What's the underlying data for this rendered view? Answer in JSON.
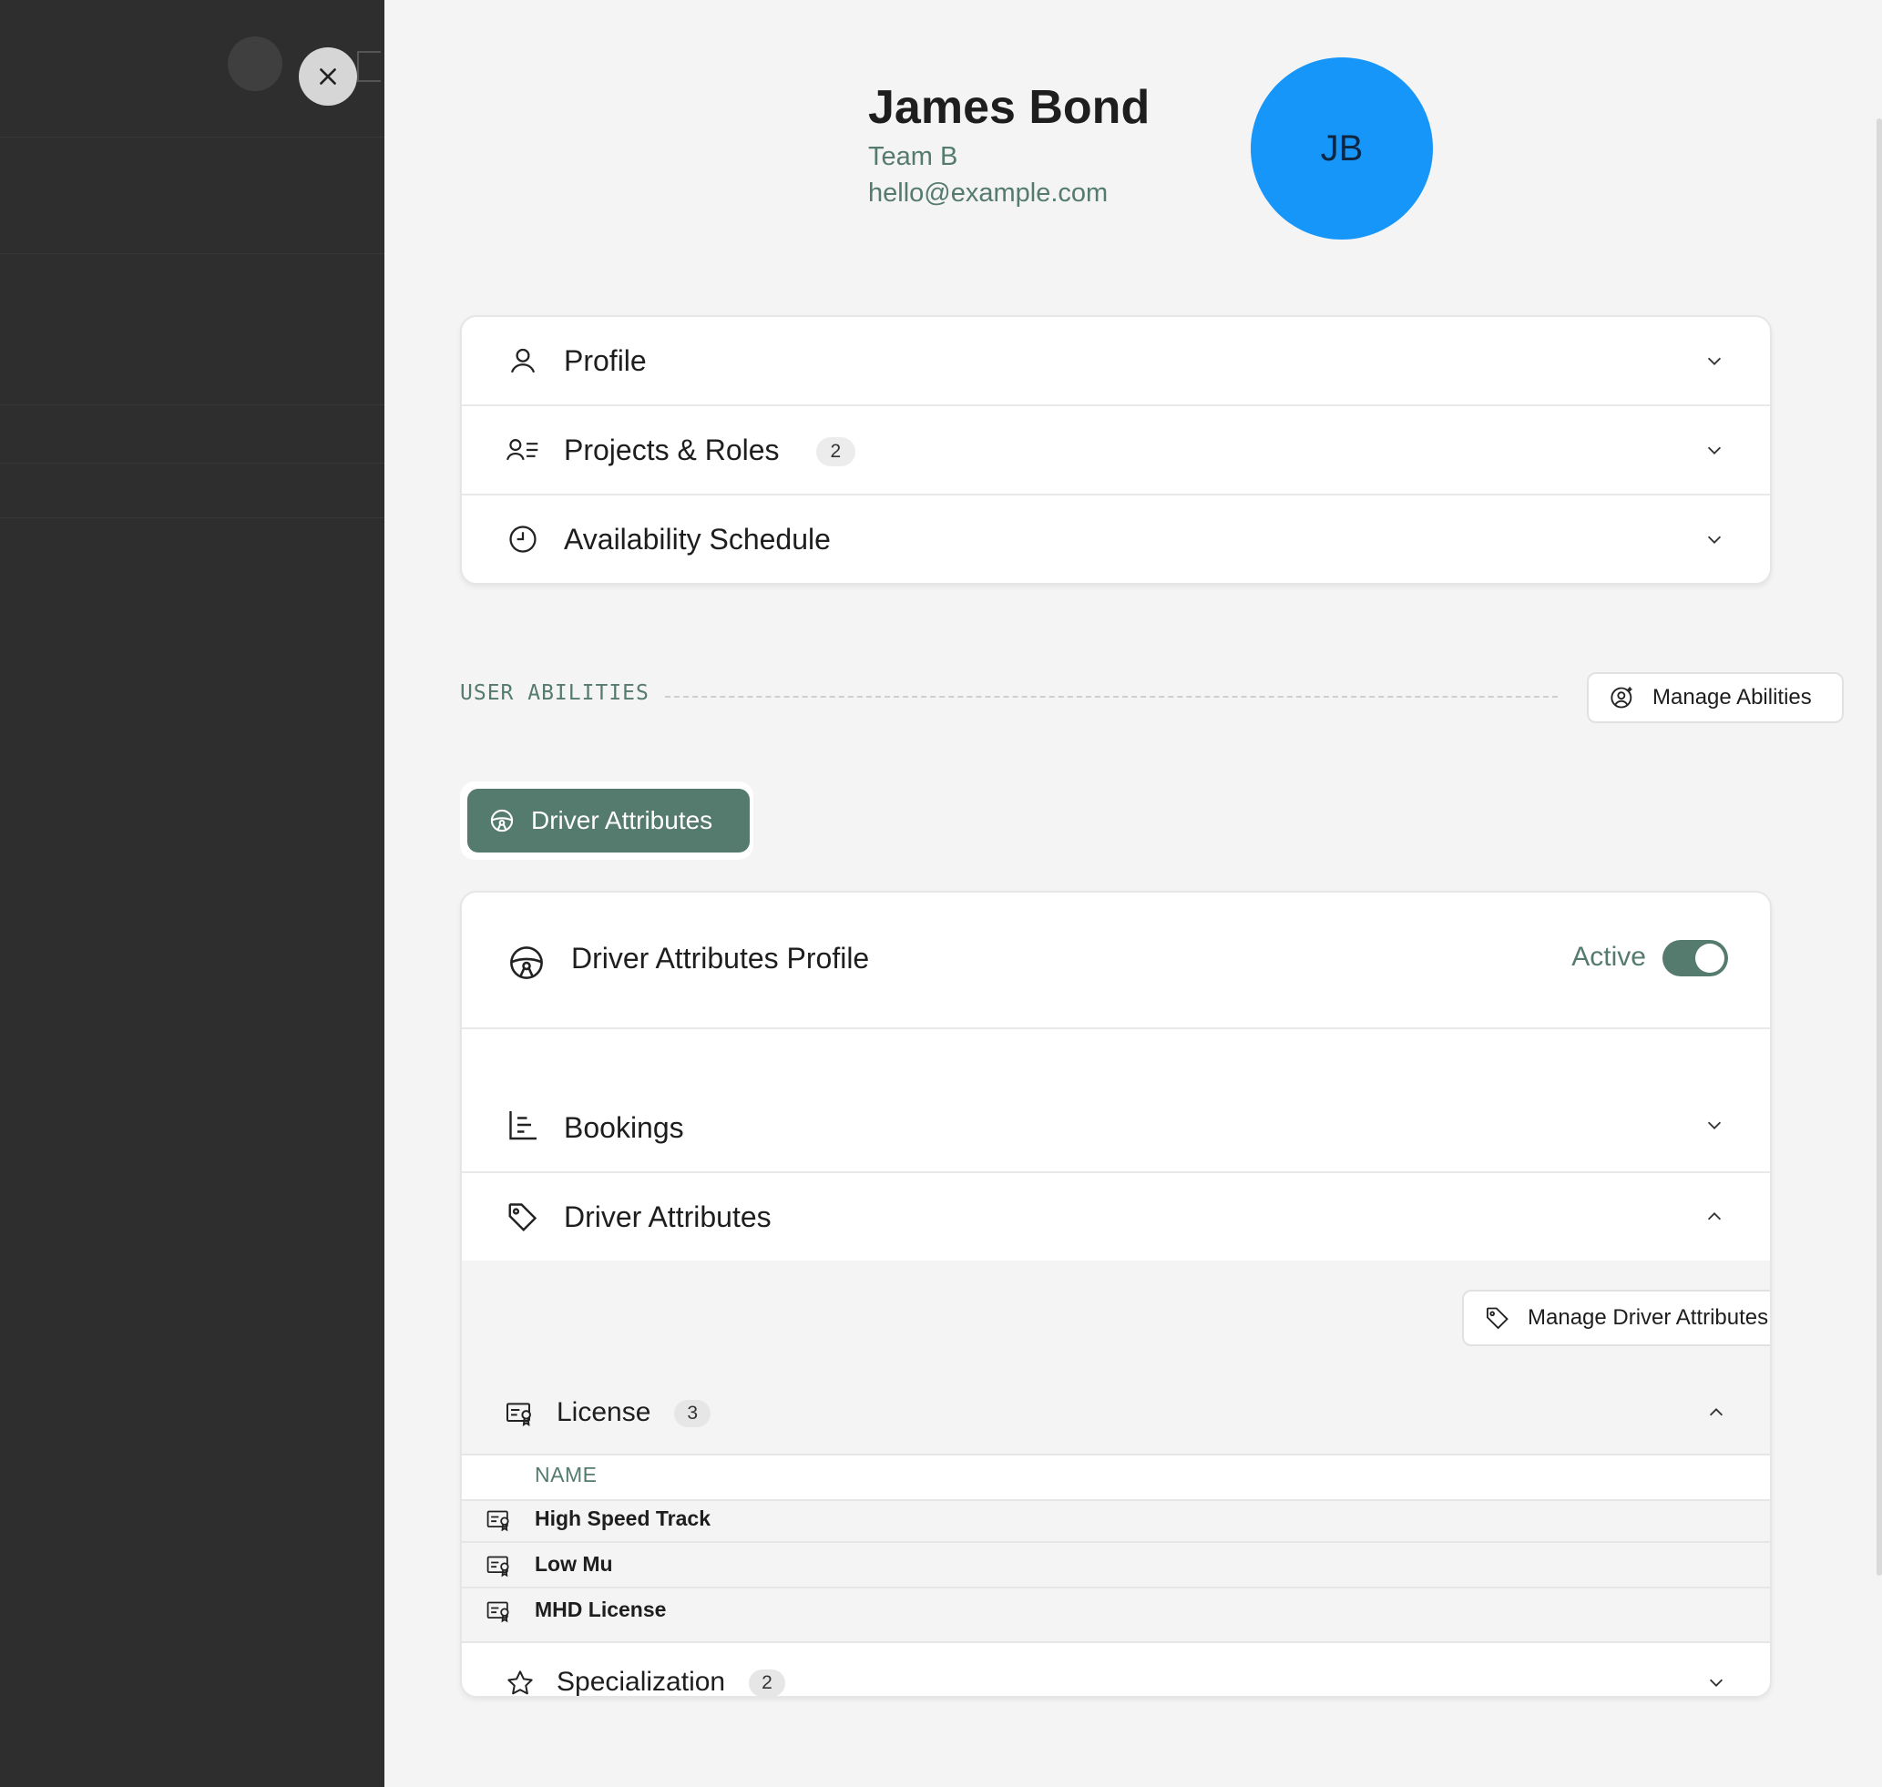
{
  "user": {
    "name": "James Bond",
    "team": "Team B",
    "email": "hello@example.com",
    "initials": "JB",
    "avatar_color": "#1796fa"
  },
  "sections": [
    {
      "label": "Profile",
      "icon": "user-icon"
    },
    {
      "label": "Projects & Roles",
      "icon": "user-list-icon",
      "count": "2"
    },
    {
      "label": "Availability Schedule",
      "icon": "clock-icon"
    }
  ],
  "abilities": {
    "heading": "USER ABILITIES",
    "manage_button": "Manage Abilities"
  },
  "tabs": [
    {
      "label": "Driver Attributes",
      "active": true
    }
  ],
  "driver_profile": {
    "title": "Driver Attributes Profile",
    "status_label": "Active",
    "active": true,
    "bookings_label": "Bookings",
    "attributes_label": "Driver Attributes",
    "manage_attributes_button": "Manage Driver Attributes",
    "license": {
      "label": "License",
      "count": "3",
      "column": "NAME",
      "items": [
        "High Speed Track",
        "Low Mu",
        "MHD License"
      ]
    },
    "specialization": {
      "label": "Specialization",
      "count": "2"
    }
  },
  "colors": {
    "accent": "#557a6e",
    "panel_bg": "#f4f4f4",
    "backdrop": "#2e2e2e"
  }
}
